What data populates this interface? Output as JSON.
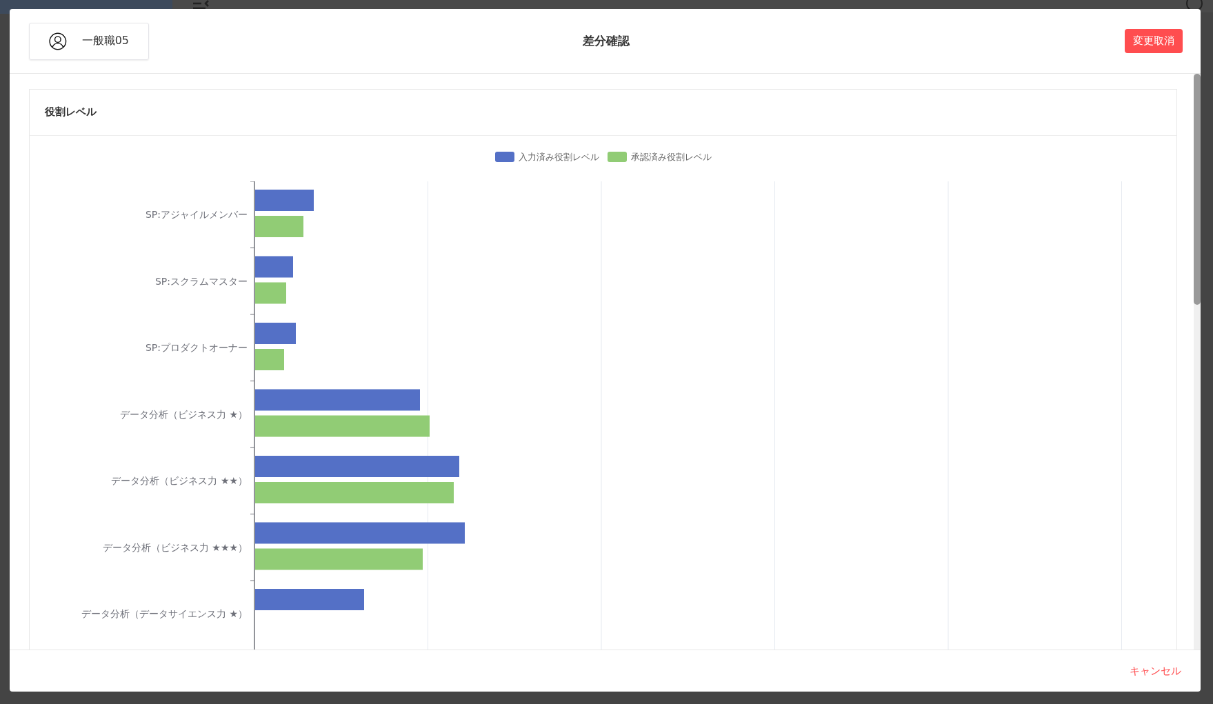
{
  "modal": {
    "user": {
      "name": "一般職05"
    },
    "title": "差分確認",
    "discard_button": "変更取消",
    "cancel_link": "キャンセル"
  },
  "card": {
    "title": "役割レベル",
    "legend": [
      {
        "label": "入力済み役割レベル",
        "color": "#5470c6"
      },
      {
        "label": "承認済み役割レベル",
        "color": "#91cc75"
      }
    ],
    "categories": [
      "SP:アジャイルメンバー",
      "SP:スクラムマスター",
      "SP:プロダクトオーナー",
      "データ分析（ビジネス力 ★）",
      "データ分析（ビジネス力 ★★）",
      "データ分析（ビジネス力 ★★★）",
      "データ分析（データサイエンス力 ★）"
    ]
  }
}
